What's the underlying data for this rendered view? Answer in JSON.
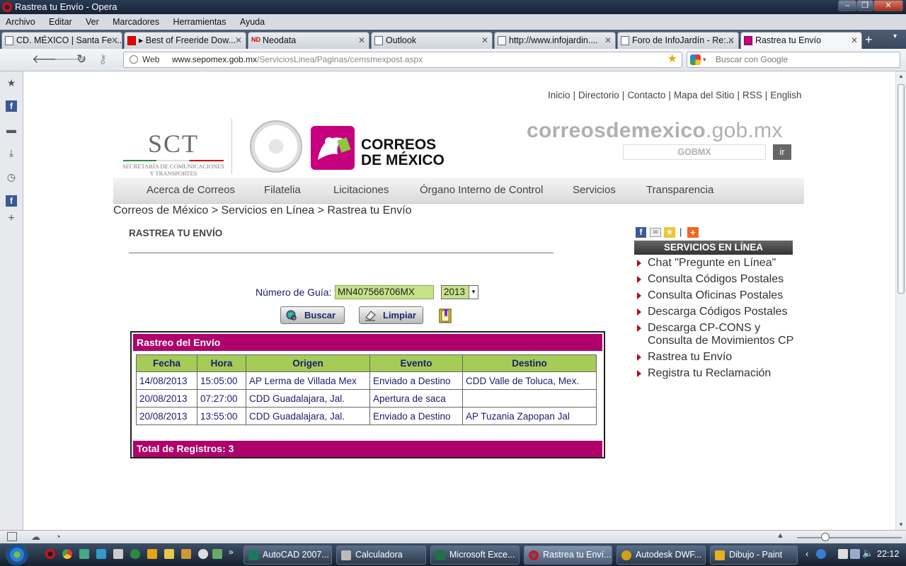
{
  "window": {
    "title": "Rastrea tu Envío - Opera"
  },
  "menu": [
    "Archivo",
    "Editar",
    "Ver",
    "Marcadores",
    "Herramientas",
    "Ayuda"
  ],
  "tabs": [
    {
      "label": "CD. MÉXICO | Santa Fe ...",
      "close": "✕"
    },
    {
      "label": "▸ Best of Freeride Dow...",
      "close": "✕"
    },
    {
      "label": "Neodata",
      "close": "✕"
    },
    {
      "label": "Outlook",
      "close": "✕"
    },
    {
      "label": "http://www.infojardin....",
      "close": "✕"
    },
    {
      "label": "Foro de InfoJardín - Re:...",
      "close": "✕"
    },
    {
      "label": "Rastrea tu Envío",
      "close": "✕"
    }
  ],
  "address": {
    "badge": "Web",
    "domain": "www.sepomex.gob.mx",
    "path": "/ServiciosLinea/Paginas/cemsmexpost.aspx",
    "search_placeholder": "Buscar con Google"
  },
  "site": {
    "top_links": [
      "Inicio",
      "Directorio",
      "Contacto",
      "Mapa del Sitio",
      "RSS",
      "English"
    ],
    "sct_logo": "SCT",
    "sct_sub": "SECRETARÍA DE COMUNICACIONES Y TRANSPORTES",
    "correos_logo_1": "CORREOS",
    "correos_logo_2": "DE MÉXICO",
    "domain_main": "correosdemexico",
    "domain_suffix": ".gob.mx",
    "gobmx_search": "GOBMX",
    "ir_button": "ir",
    "nav": [
      "Acerca de Correos",
      "Filatelia",
      "Licitaciones",
      "Órgano Interno de Control",
      "Servicios",
      "Transparencia"
    ],
    "breadcrumb": "Correos de México > Servicios en Línea > Rastrea tu Envío",
    "page_title": "RASTREA TU ENVÍO",
    "guia_label": "Número de Guía:",
    "guia_value": "MN407566706MX",
    "year_value": "2013",
    "buscar_label": "Buscar",
    "limpiar_label": "Limpiar",
    "results": {
      "title": "Rastreo del Envío",
      "columns": [
        "Fecha",
        "Hora",
        "Origen",
        "Evento",
        "Destino"
      ],
      "rows": [
        [
          "14/08/2013",
          "15:05:00",
          "AP Lerma de Villada Mex",
          "Enviado a Destino",
          "CDD Valle de Toluca, Mex."
        ],
        [
          "20/08/2013",
          "07:27:00",
          "CDD Guadalajara, Jal.",
          "Apertura de saca",
          ""
        ],
        [
          "20/08/2013",
          "13:55:00",
          "CDD Guadalajara, Jal.",
          "Enviado a Destino",
          "AP Tuzania Zapopan Jal"
        ]
      ],
      "total": "Total de Registros: 3"
    },
    "services_header": "SERVICIOS EN LÍNEA",
    "services": [
      "Chat \"Pregunte en Línea\"",
      "Consulta Códigos Postales",
      "Consulta Oficinas Postales",
      "Descarga Códigos Postales",
      "Descarga CP-CONS y Consulta de Movimientos CP",
      "Rastrea tu Envío",
      "Registra tu Reclamación"
    ]
  },
  "taskbar": {
    "items": [
      "AutoCAD 2007...",
      "Calculadora",
      "Microsoft Exce...",
      "Rastrea tu Enví...",
      "Autodesk DWF...",
      "Dibujo - Paint"
    ],
    "clock": "22:12"
  }
}
